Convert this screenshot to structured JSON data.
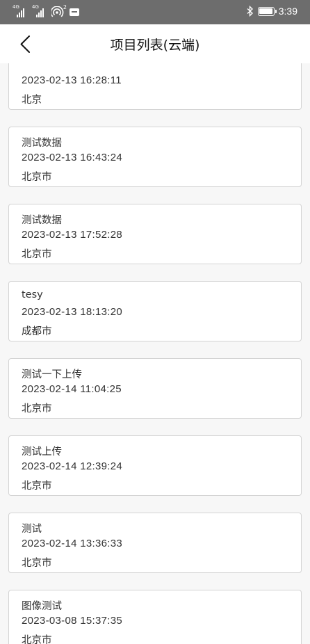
{
  "status_bar": {
    "signal_1_label": "4G",
    "signal_2_label": "4G",
    "hotspot_badge": "2",
    "time": "3:39",
    "icons": [
      "signal-icon",
      "signal-icon",
      "hotspot-icon",
      "message-icon",
      "bluetooth-icon",
      "battery-icon"
    ]
  },
  "header": {
    "title": "项目列表(云端)",
    "back_icon": "chevron-left-icon"
  },
  "projects": [
    {
      "name": "",
      "time": "2023-02-13 16:28:11",
      "city": "北京"
    },
    {
      "name": "测试数据",
      "time": "2023-02-13 16:43:24",
      "city": "北京市"
    },
    {
      "name": "测试数据",
      "time": "2023-02-13 17:52:28",
      "city": "北京市"
    },
    {
      "name": "tesy",
      "time": "2023-02-13 18:13:20",
      "city": "成都市"
    },
    {
      "name": "测试一下上传",
      "time": "2023-02-14 11:04:25",
      "city": "北京市"
    },
    {
      "name": "测试上传",
      "time": "2023-02-14 12:39:24",
      "city": "北京市"
    },
    {
      "name": "测试",
      "time": "2023-02-14 13:36:33",
      "city": "北京市"
    },
    {
      "name": "图像测试",
      "time": "2023-03-08 15:37:35",
      "city": "北京市"
    }
  ]
}
